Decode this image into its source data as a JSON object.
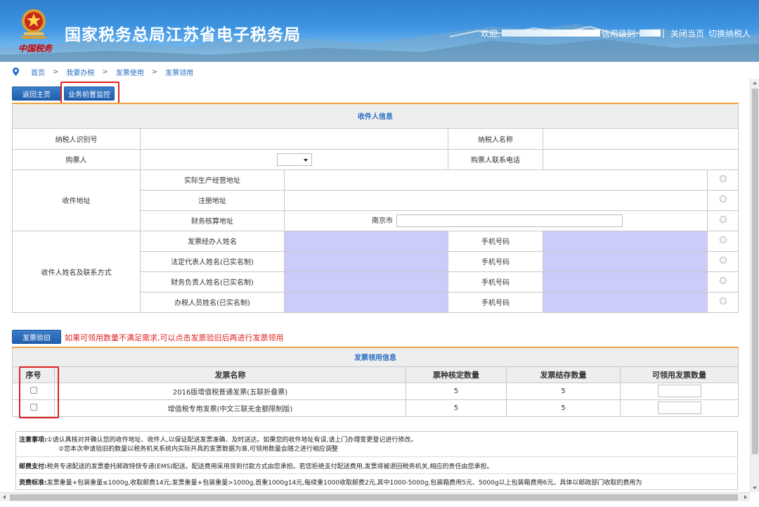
{
  "header": {
    "title": "国家税务总局江苏省电子税务局",
    "emblem_caption": "中国税务",
    "welcome": "欢迎,",
    "credit_label": "信用级别:",
    "close_page": "关闭当页",
    "switch_taxpayer": "切换纳税人",
    "separator": "|"
  },
  "breadcrumb": {
    "items": [
      "首页",
      "我要办税",
      "发票使用",
      "发票领用"
    ],
    "arrow": ">"
  },
  "buttons": {
    "back_home": "返回主页",
    "business_monitor": "业务前置监控",
    "invoice_verify": "发票验旧"
  },
  "hint": "如果可领用数量不满足需求,可以点击发票验旧后再进行发票领用",
  "recipient": {
    "caption": "收件人信息",
    "taxpayer_id_label": "纳税人识别号",
    "taxpayer_name_label": "纳税人名称",
    "buyer_label": "购票人",
    "buyer_phone_label": "购票人联系电话",
    "address_label": "收件地址",
    "addresses": [
      {
        "label": "实际生产经营地址",
        "prefix": "",
        "value": ""
      },
      {
        "label": "注册地址",
        "prefix": "",
        "value": ""
      },
      {
        "label": "财务核算地址",
        "prefix": "南京市",
        "value": ""
      }
    ],
    "contact_label": "收件人姓名及联系方式",
    "contacts": [
      {
        "label": "发票经办人姓名",
        "phone_label": "手机号码"
      },
      {
        "label": "法定代表人姓名(已实名制)",
        "phone_label": "手机号码"
      },
      {
        "label": "财务负责人姓名(已实名制)",
        "phone_label": "手机号码"
      },
      {
        "label": "办税人员姓名(已实名制)",
        "phone_label": "手机号码"
      }
    ]
  },
  "invoice": {
    "caption": "发票领用信息",
    "columns": [
      "序号",
      "发票名称",
      "票种核定数量",
      "发票结存数量",
      "可领用发票数量"
    ],
    "rows": [
      {
        "name": "2016版增值税普通发票(五联折叠票)",
        "approved": "5",
        "stock": "5"
      },
      {
        "name": "增值税专用发票(中文三联无金额限制版)",
        "approved": "5",
        "stock": "5"
      }
    ]
  },
  "notes": {
    "attention_label": "注意事项:",
    "attention_1": "①请认真核对并确认您的收件地址、收件人,以保证配送发票准确、及时送达。如果您的收件地址有误,请上门办理变更登记进行修改。",
    "attention_2": "②您本次申请验旧的数量以税务机关系统内实际开具的发票数据为准,可领用数量会随之进行相应调整",
    "postage_label": "邮费支付:",
    "postage_text": "税务专递配送的发票委托邮政特快专递(EMS)配送。配送费用采用货到付款方式由您承担。若您拒绝支付配送费用,发票将被退回税务机关,相应的责任由您承担。",
    "fee_label": "资费标准:",
    "fee_text": "发票重量+包装重量≤1000g,收取邮费14元;发票重量+包装重量>1000g,首重1000g14元,每续重1000收取邮费2元,其中1000-5000g,包装箱费用5元、5000g以上包装箱费用6元。具体以邮政部门收取的费用为"
  },
  "colors": {
    "header_blue": "#3f95e2",
    "button_blue": "#1f5fae",
    "link_blue": "#2a6fc4",
    "highlight_red": "#e02020",
    "contact_input": "#ccccfb",
    "caption_border": "#f3a23c"
  }
}
